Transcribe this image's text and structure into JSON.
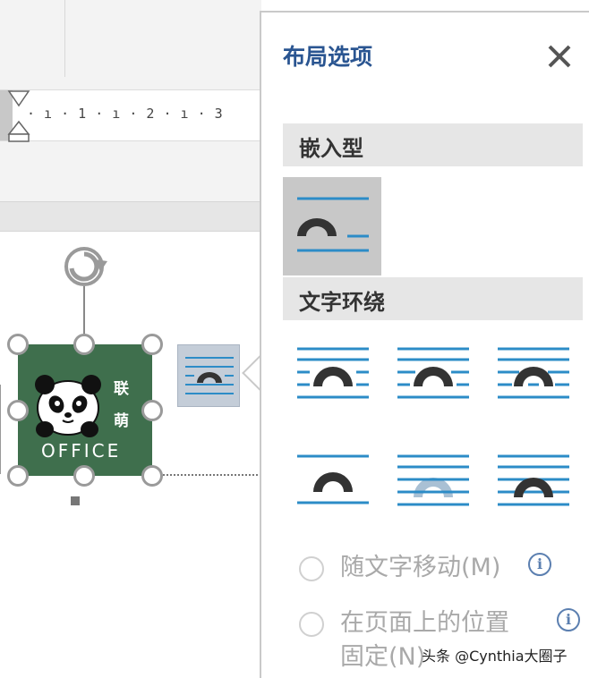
{
  "ruler": {
    "ticks": "· ı · 1 · ı · 2 · ı · 3"
  },
  "image": {
    "label_line1": "联",
    "label_line2": "萌",
    "label_office": "OFFICE"
  },
  "pane": {
    "title": "布局选项",
    "close_icon": "close-icon",
    "section_inline": "嵌入型",
    "section_wrap": "文字环绕",
    "wrap_options": [
      "square",
      "tight",
      "through",
      "top-and-bottom",
      "behind-text",
      "in-front-of-text"
    ],
    "radio_move": "随文字移动(M)",
    "radio_fix_line1": "在页面上的位置",
    "radio_fix_line2": "固定(N)"
  },
  "watermark": "头条 @Cynthia大圈子",
  "colors": {
    "accent": "#2a5591",
    "wrap_line": "#2c8cc7",
    "image_bg": "#3f6f4d"
  }
}
